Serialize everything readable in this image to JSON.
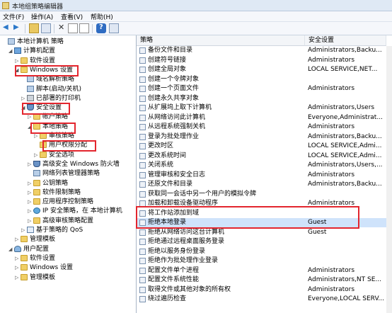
{
  "window": {
    "title": "本地组策略编辑器"
  },
  "menu": [
    "文件(F)",
    "操作(A)",
    "查看(V)",
    "帮助(H)"
  ],
  "toolbar": [
    "back-icon",
    "forward-icon",
    "up-folder-icon",
    "show-tree-icon",
    "delete-icon",
    "properties-icon",
    "export-list-icon",
    "help-icon",
    "view-icon"
  ],
  "tree": [
    {
      "label": "本地计算机 策略",
      "depth": 0,
      "toggle": "",
      "icon": "policy"
    },
    {
      "label": "计算机配置",
      "depth": 1,
      "toggle": "◢",
      "icon": "pc"
    },
    {
      "label": "软件设置",
      "depth": 2,
      "toggle": "▷",
      "icon": "folder"
    },
    {
      "label": "Windows 设置",
      "depth": 2,
      "toggle": "◢",
      "icon": "folder"
    },
    {
      "label": "域名解析策略",
      "depth": 3,
      "toggle": "",
      "icon": "policy"
    },
    {
      "label": "脚本(启动/关机)",
      "depth": 3,
      "toggle": "",
      "icon": "policy"
    },
    {
      "label": "已部署的打印机",
      "depth": 3,
      "toggle": "▷",
      "icon": "printer"
    },
    {
      "label": "安全设置",
      "depth": 3,
      "toggle": "◢",
      "icon": "shield"
    },
    {
      "label": "帐户策略",
      "depth": 4,
      "toggle": "▷",
      "icon": "folder"
    },
    {
      "label": "本地策略",
      "depth": 4,
      "toggle": "◢",
      "icon": "folder"
    },
    {
      "label": "审核策略",
      "depth": 5,
      "toggle": "▷",
      "icon": "folder"
    },
    {
      "label": "用户权限分配",
      "depth": 5,
      "toggle": "",
      "icon": "folder"
    },
    {
      "label": "安全选项",
      "depth": 5,
      "toggle": "▷",
      "icon": "folder"
    },
    {
      "label": "高级安全 Windows 防火墙",
      "depth": 4,
      "toggle": "▷",
      "icon": "shield"
    },
    {
      "label": "网络列表管理器策略",
      "depth": 4,
      "toggle": "",
      "icon": "policy"
    },
    {
      "label": "公钥策略",
      "depth": 4,
      "toggle": "▷",
      "icon": "folder"
    },
    {
      "label": "软件限制策略",
      "depth": 4,
      "toggle": "▷",
      "icon": "folder"
    },
    {
      "label": "应用程序控制策略",
      "depth": 4,
      "toggle": "▷",
      "icon": "folder"
    },
    {
      "label": "IP 安全策略，在 本地计算机",
      "depth": 4,
      "toggle": "▷",
      "icon": "globe"
    },
    {
      "label": "高级审核策略配置",
      "depth": 4,
      "toggle": "▷",
      "icon": "folder"
    },
    {
      "label": "基于策略的 QoS",
      "depth": 3,
      "toggle": "▷",
      "icon": "chart"
    },
    {
      "label": "管理模板",
      "depth": 2,
      "toggle": "▷",
      "icon": "folder"
    },
    {
      "label": "用户配置",
      "depth": 1,
      "toggle": "◢",
      "icon": "user"
    },
    {
      "label": "软件设置",
      "depth": 2,
      "toggle": "▷",
      "icon": "folder"
    },
    {
      "label": "Windows 设置",
      "depth": 2,
      "toggle": "▷",
      "icon": "folder"
    },
    {
      "label": "管理模板",
      "depth": 2,
      "toggle": "▷",
      "icon": "folder"
    }
  ],
  "table": {
    "headers": [
      "策略",
      "安全设置"
    ],
    "rows": [
      [
        "备份文件和目录",
        "Administrators,Backu..."
      ],
      [
        "创建符号链接",
        "Administrators"
      ],
      [
        "创建全局对象",
        "LOCAL SERVICE,NET..."
      ],
      [
        "创建一个令牌对象",
        ""
      ],
      [
        "创建一个页面文件",
        "Administrators"
      ],
      [
        "创建永久共享对象",
        ""
      ],
      [
        "从扩展坞上取下计算机",
        "Administrators,Users"
      ],
      [
        "从网络访问此计算机",
        "Everyone,Administrat..."
      ],
      [
        "从远程系统强制关机",
        "Administrators"
      ],
      [
        "登录为批处理作业",
        "Administrators,Backu..."
      ],
      [
        "更改时区",
        "LOCAL SERVICE,Admi..."
      ],
      [
        "更改系统时间",
        "LOCAL SERVICE,Admi..."
      ],
      [
        "关闭系统",
        "Administrators,Users,..."
      ],
      [
        "管理审核和安全日志",
        "Administrators"
      ],
      [
        "还原文件和目录",
        "Administrators,Backu..."
      ],
      [
        "获取同一会话中另一个用户的模拟令牌",
        ""
      ],
      [
        "加载和卸载设备驱动程序",
        "Administrators"
      ],
      [
        "将工作站添加到域",
        ""
      ],
      [
        "拒绝本地登录",
        "Guest"
      ],
      [
        "拒绝从网络访问这台计算机",
        "Guest"
      ],
      [
        "拒绝通过远程桌面服务登录",
        ""
      ],
      [
        "拒绝以服务身份登录",
        ""
      ],
      [
        "拒绝作为批处理作业登录",
        ""
      ],
      [
        "配置文件单个进程",
        "Administrators"
      ],
      [
        "配置文件系统性能",
        "Administrators,NT SE..."
      ],
      [
        "取得文件或其他对象的所有权",
        "Administrators"
      ],
      [
        "绕过遍历检查",
        "Everyone,LOCAL SERV..."
      ]
    ]
  }
}
